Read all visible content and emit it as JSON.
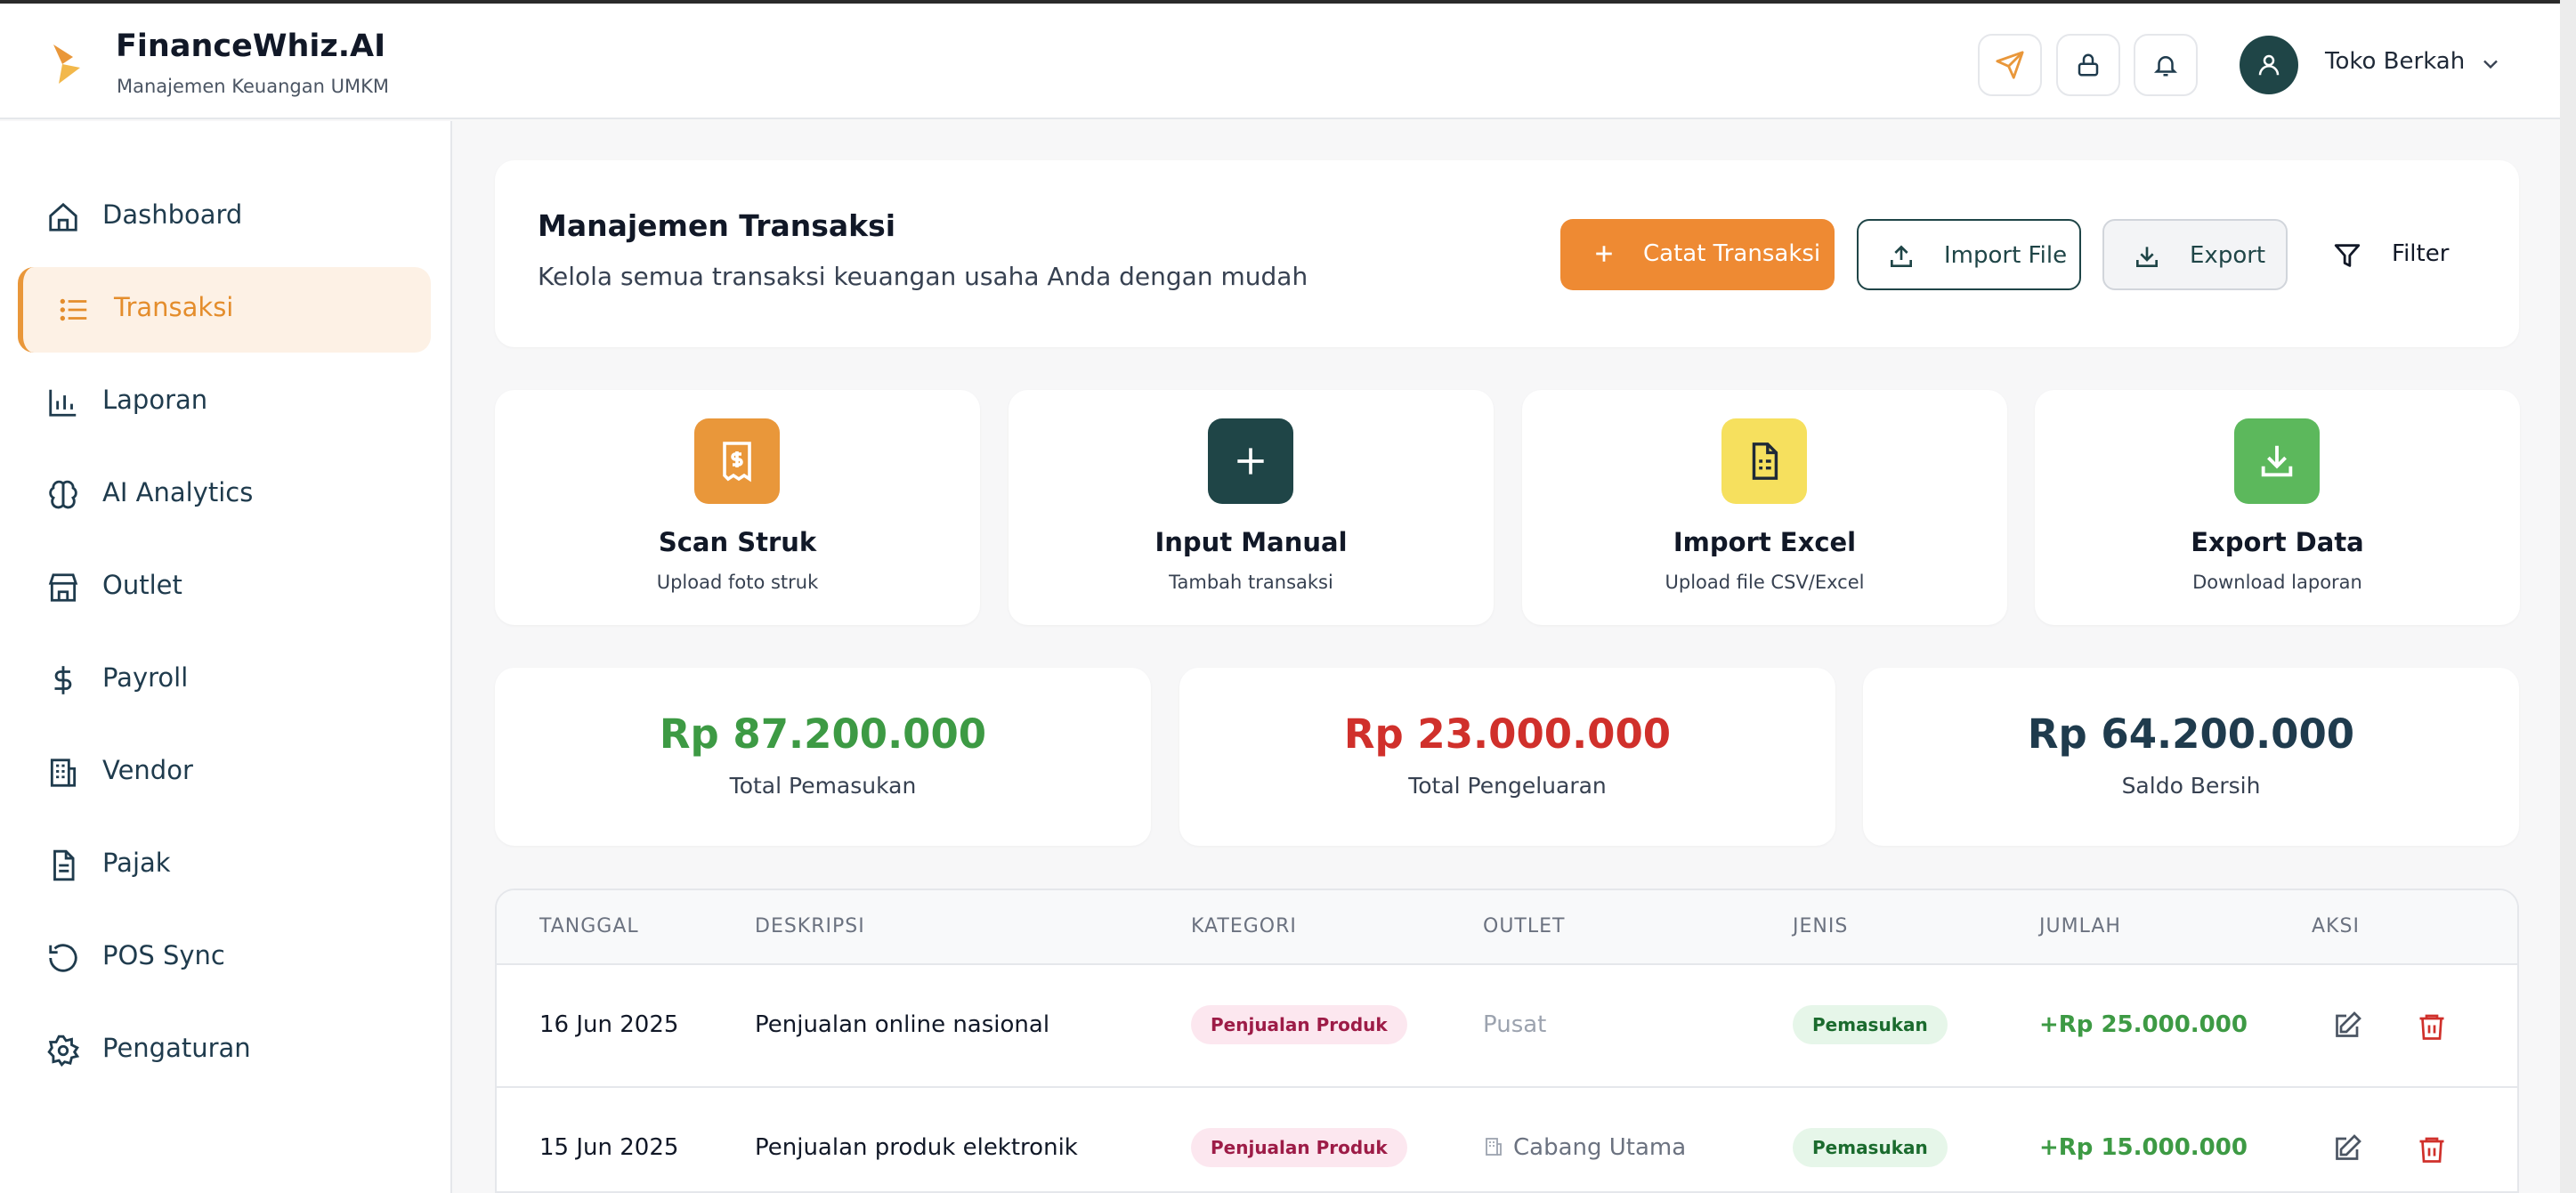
{
  "app": {
    "title": "FinanceWhiz.AI",
    "subtitle": "Manajemen Keuangan UMKM",
    "user_name": "Toko Berkah"
  },
  "topbar": {
    "icons": [
      "send-icon",
      "lock-icon",
      "bell-icon"
    ]
  },
  "sidebar": {
    "items": [
      {
        "label": "Dashboard",
        "icon": "home-icon",
        "active": false
      },
      {
        "label": "Transaksi",
        "icon": "list-icon",
        "active": true
      },
      {
        "label": "Laporan",
        "icon": "bar-chart-icon",
        "active": false
      },
      {
        "label": "AI Analytics",
        "icon": "brain-icon",
        "active": false
      },
      {
        "label": "Outlet",
        "icon": "store-icon",
        "active": false
      },
      {
        "label": "Payroll",
        "icon": "dollar-icon",
        "active": false
      },
      {
        "label": "Vendor",
        "icon": "building-icon",
        "active": false
      },
      {
        "label": "Pajak",
        "icon": "document-icon",
        "active": false
      },
      {
        "label": "POS Sync",
        "icon": "refresh-icon",
        "active": false
      },
      {
        "label": "Pengaturan",
        "icon": "gear-icon",
        "active": false
      }
    ]
  },
  "header": {
    "title": "Manajemen Transaksi",
    "subtitle": "Kelola semua transaksi keuangan usaha Anda dengan mudah",
    "buttons": {
      "add": "Catat Transaksi",
      "import": "Import File",
      "export": "Export",
      "filter": "Filter"
    }
  },
  "quick_actions": [
    {
      "title": "Scan Struk",
      "subtitle": "Upload foto struk",
      "icon": "receipt-icon",
      "color": "#e9973a"
    },
    {
      "title": "Input Manual",
      "subtitle": "Tambah transaksi",
      "icon": "plus-icon",
      "color": "#1f4547"
    },
    {
      "title": "Import Excel",
      "subtitle": "Upload file CSV/Excel",
      "icon": "spreadsheet-icon",
      "color": "#f6e05e"
    },
    {
      "title": "Export Data",
      "subtitle": "Download laporan",
      "icon": "download-icon",
      "color": "#5cb85c"
    }
  ],
  "stats": [
    {
      "value": "Rp 87.200.000",
      "label": "Total Pemasukan",
      "color": "#3d9a44"
    },
    {
      "value": "Rp 23.000.000",
      "label": "Total Pengeluaran",
      "color": "#d0302b"
    },
    {
      "value": "Rp 64.200.000",
      "label": "Saldo Bersih",
      "color": "#1f3b4d"
    }
  ],
  "table": {
    "columns": [
      "TANGGAL",
      "DESKRIPSI",
      "KATEGORI",
      "OUTLET",
      "JENIS",
      "JUMLAH",
      "AKSI"
    ],
    "rows": [
      {
        "date": "16 Jun 2025",
        "description": "Penjualan online nasional",
        "category": "Penjualan Produk",
        "outlet": "Pusat",
        "type": "Pemasukan",
        "amount": "+Rp 25.000.000"
      },
      {
        "date": "15 Jun 2025",
        "description": "Penjualan produk elektronik",
        "category": "Penjualan Produk",
        "outlet": "Cabang Utama",
        "type": "Pemasukan",
        "amount": "+Rp 15.000.000"
      }
    ]
  }
}
